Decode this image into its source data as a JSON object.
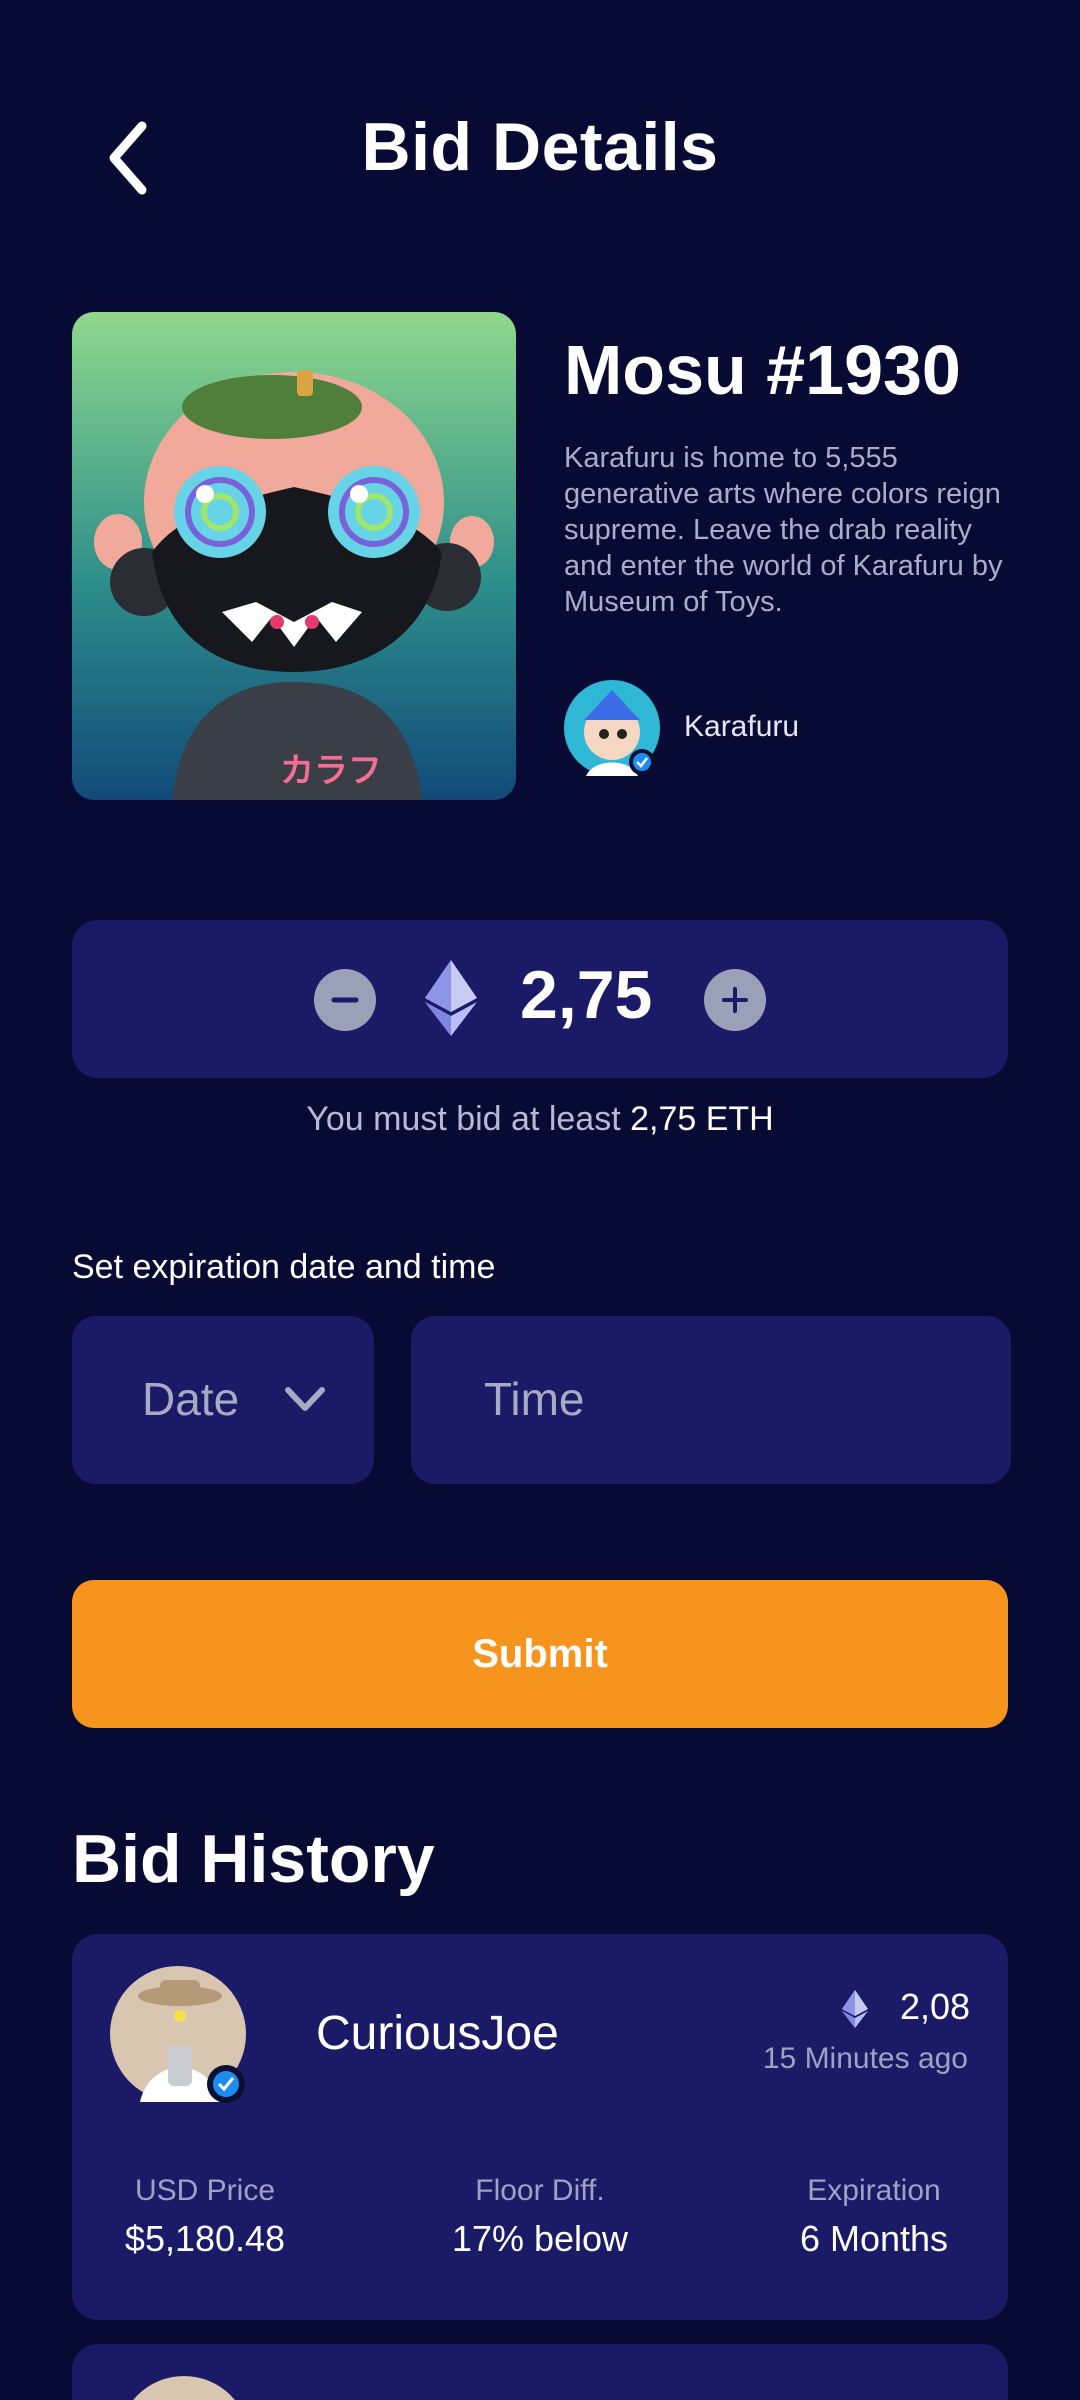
{
  "header": {
    "title": "Bid Details"
  },
  "nft": {
    "name": "Mosu #1930",
    "description": "Karafuru is home to 5,555 generative arts where colors reign supreme. Leave the drab reality and enter the world of Karafuru by Museum of Toys.",
    "creator": "Karafuru",
    "image_glyph": "カラフ"
  },
  "bid": {
    "amount": "2,75",
    "hint_prefix": "You must bid at least",
    "hint_amount": "2,75 ETH"
  },
  "expiration": {
    "label": "Set expiration date and time",
    "date_placeholder": "Date",
    "time_placeholder": "Time"
  },
  "submit_label": "Submit",
  "history": {
    "title": "Bid History",
    "entries": [
      {
        "bidder": "CuriousJoe",
        "eth": "2,08",
        "time_ago": "15 Minutes ago",
        "usd_label": "USD Price",
        "usd_value": "$5,180.48",
        "floor_label": "Floor Diff.",
        "floor_value": "17% below",
        "exp_label": "Expiration",
        "exp_value": "6 Months"
      }
    ]
  },
  "colors": {
    "background": "#070b33",
    "card": "#1a1a66",
    "accent": "#f7941d",
    "verified": "#1d8cf0"
  },
  "icons": {
    "back": "chevron-left-icon",
    "minus": "minus-icon",
    "plus": "plus-icon",
    "eth": "ethereum-icon",
    "dropdown": "chevron-down-icon",
    "verified": "verified-badge-icon"
  }
}
